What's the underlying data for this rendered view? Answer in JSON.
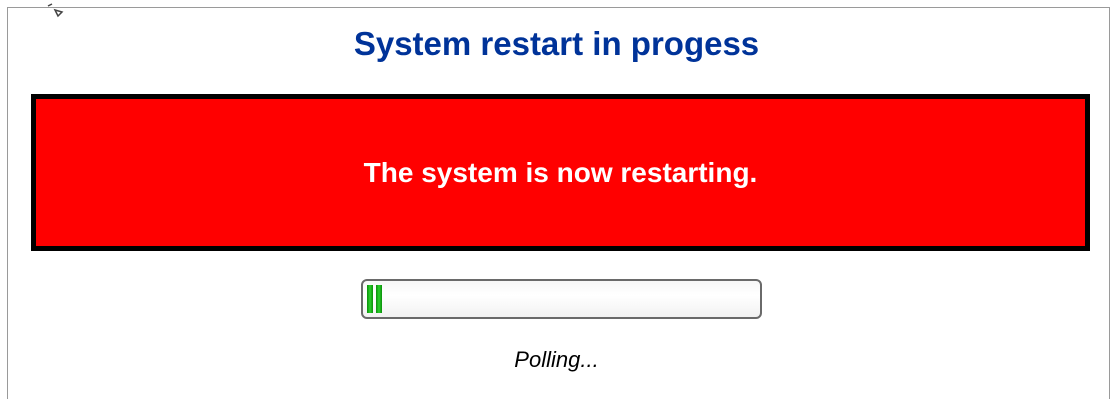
{
  "page": {
    "title": "System restart in progess",
    "title_color": "#003399",
    "cursor_icon": "arrow-cursor-icon"
  },
  "alert": {
    "message": "The system is now restarting.",
    "background_color": "#ff0000",
    "text_color": "#ffffff"
  },
  "progress": {
    "value_fraction": 0.05,
    "fill_color": "#22bb22",
    "status_text": "Polling..."
  }
}
